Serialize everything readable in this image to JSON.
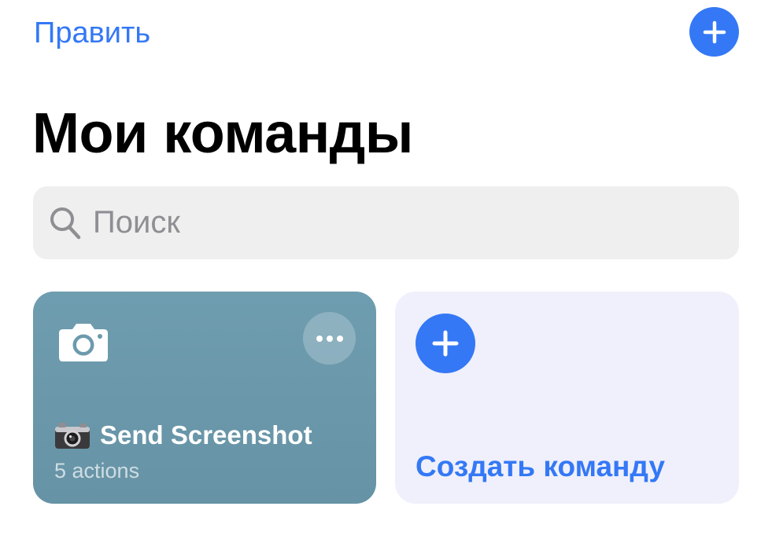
{
  "colors": {
    "accent": "#3478f6",
    "shortcut_card": "#6a97a9",
    "create_card": "#eff0fb",
    "search_bg": "#efeff0"
  },
  "nav": {
    "edit_label": "Править",
    "add_icon": "plus-icon"
  },
  "page_title": "Мои команды",
  "search": {
    "placeholder": "Поиск",
    "value": "",
    "icon": "search-icon"
  },
  "shortcuts": [
    {
      "icon": "camera-icon",
      "emoji_icon": "camera-emoji-icon",
      "name": "Send Screenshot",
      "meta": "5 actions",
      "more_icon": "ellipsis-icon"
    }
  ],
  "create": {
    "label": "Создать команду",
    "icon": "plus-icon"
  }
}
